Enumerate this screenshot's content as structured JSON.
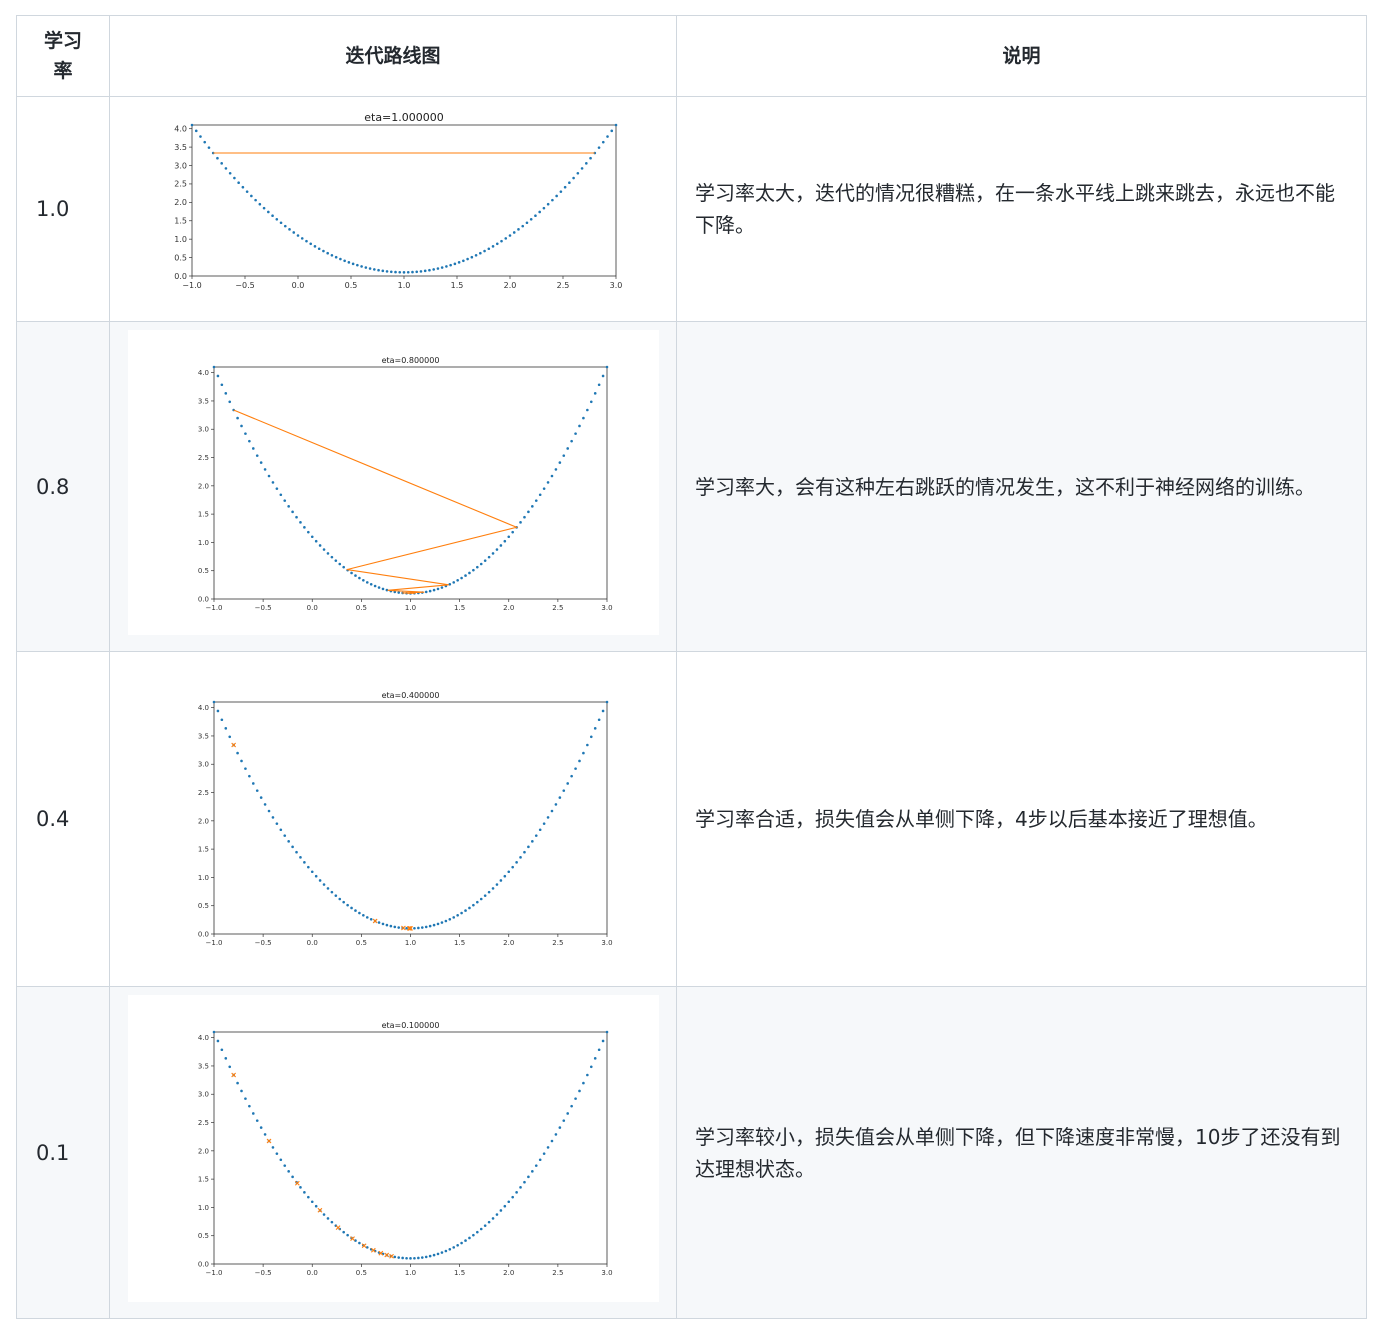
{
  "table": {
    "headers": {
      "rate": "学习率",
      "figure": "迭代路线图",
      "description": "说明"
    },
    "rows": [
      {
        "rate": "1.0",
        "description": "学习率太大，迭代的情况很糟糕，在一条水平线上跳来跳去，永远也不能下降。"
      },
      {
        "rate": "0.8",
        "description": "学习率大，会有这种左右跳跃的情况发生，这不利于神经网络的训练。"
      },
      {
        "rate": "0.4",
        "description": "学习率合适，损失值会从单侧下降，4步以后基本接近了理想值。"
      },
      {
        "rate": "0.1",
        "description": "学习率较小，损失值会从单侧下降，但下降速度非常慢，10步了还没有到达理想状态。"
      }
    ]
  },
  "chart_data": [
    {
      "type": "scatter",
      "title": "eta=1.000000",
      "xlabel": "",
      "ylabel": "",
      "xlim": [
        -1.0,
        3.0
      ],
      "ylim": [
        0.0,
        4.1
      ],
      "xticks": [
        "−1.0",
        "−0.5",
        "0.0",
        "0.5",
        "1.0",
        "1.5",
        "2.0",
        "2.5",
        "3.0"
      ],
      "yticks": [
        "0.0",
        "0.5",
        "1.0",
        "1.5",
        "2.0",
        "2.5",
        "3.0",
        "3.5",
        "4.0"
      ],
      "series": [
        {
          "kind": "curve",
          "function": "(x-1)^2+0.1",
          "x_range": [
            -1.0,
            3.0
          ],
          "color": "#1f77b4"
        },
        {
          "kind": "path",
          "color": "#ff7f0e",
          "x": [
            -0.8,
            2.8,
            -0.8,
            2.8
          ]
        }
      ]
    },
    {
      "type": "scatter",
      "title": "eta=0.800000",
      "xlabel": "",
      "ylabel": "",
      "xlim": [
        -1.0,
        3.0
      ],
      "ylim": [
        0.0,
        4.1
      ],
      "xticks": [
        "−1.0",
        "−0.5",
        "0.0",
        "0.5",
        "1.0",
        "1.5",
        "2.0",
        "2.5",
        "3.0"
      ],
      "yticks": [
        "0.0",
        "0.5",
        "1.0",
        "1.5",
        "2.0",
        "2.5",
        "3.0",
        "3.5",
        "4.0"
      ],
      "series": [
        {
          "kind": "curve",
          "function": "(x-1)^2+0.1",
          "x_range": [
            -1.0,
            3.0
          ],
          "color": "#1f77b4"
        },
        {
          "kind": "path",
          "color": "#ff7f0e",
          "x": [
            -0.8,
            2.08,
            0.352,
            1.389,
            0.767,
            1.14,
            0.916,
            1.05,
            0.97,
            1.018,
            0.989
          ]
        }
      ]
    },
    {
      "type": "scatter",
      "title": "eta=0.400000",
      "xlabel": "",
      "ylabel": "",
      "xlim": [
        -1.0,
        3.0
      ],
      "ylim": [
        0.0,
        4.1
      ],
      "xticks": [
        "−1.0",
        "−0.5",
        "0.0",
        "0.5",
        "1.0",
        "1.5",
        "2.0",
        "2.5",
        "3.0"
      ],
      "yticks": [
        "0.0",
        "0.5",
        "1.0",
        "1.5",
        "2.0",
        "2.5",
        "3.0",
        "3.5",
        "4.0"
      ],
      "series": [
        {
          "kind": "curve",
          "function": "(x-1)^2+0.1",
          "x_range": [
            -1.0,
            3.0
          ],
          "color": "#1f77b4"
        },
        {
          "kind": "points",
          "color": "#ff7f0e",
          "x": [
            -0.8,
            0.64,
            0.928,
            0.986,
            0.997,
            0.999,
            1.0
          ]
        }
      ]
    },
    {
      "type": "scatter",
      "title": "eta=0.100000",
      "xlabel": "",
      "ylabel": "",
      "xlim": [
        -1.0,
        3.0
      ],
      "ylim": [
        0.0,
        4.1
      ],
      "xticks": [
        "−1.0",
        "−0.5",
        "0.0",
        "0.5",
        "1.0",
        "1.5",
        "2.0",
        "2.5",
        "3.0"
      ],
      "yticks": [
        "0.0",
        "0.5",
        "1.0",
        "1.5",
        "2.0",
        "2.5",
        "3.0",
        "3.5",
        "4.0"
      ],
      "series": [
        {
          "kind": "curve",
          "function": "(x-1)^2+0.1",
          "x_range": [
            -1.0,
            3.0
          ],
          "color": "#1f77b4"
        },
        {
          "kind": "points",
          "color": "#ff7f0e",
          "x": [
            -0.8,
            -0.44,
            -0.152,
            0.078,
            0.263,
            0.41,
            0.528,
            0.622,
            0.698,
            0.758,
            0.807
          ]
        }
      ]
    }
  ]
}
